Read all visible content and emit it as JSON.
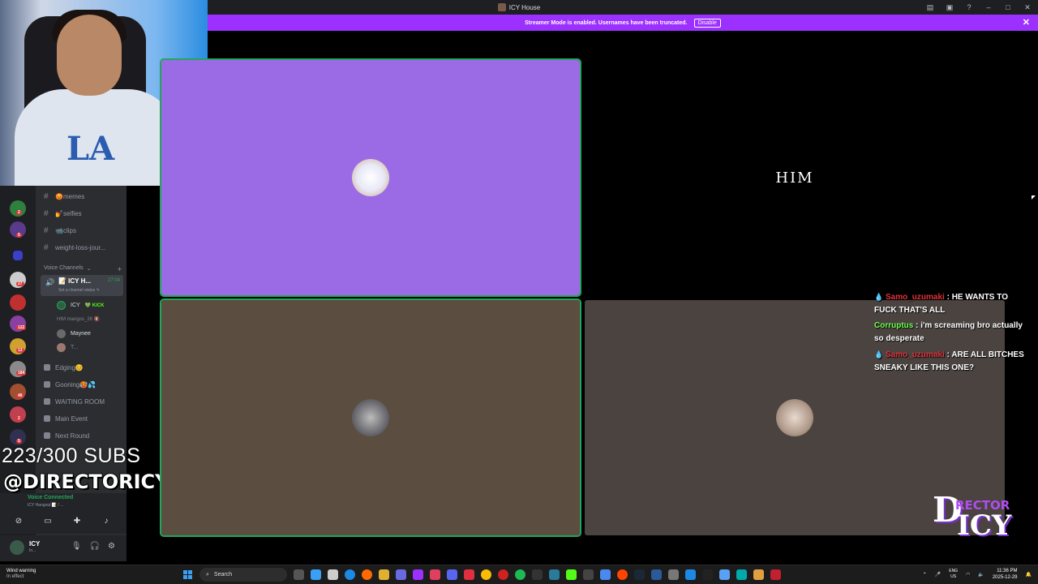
{
  "window": {
    "title": "ICY House"
  },
  "banner": {
    "text": "Streamer Mode is enabled. Usernames have been truncated.",
    "disable_label": "Disable",
    "close": "✕"
  },
  "rail_badges": [
    "2",
    "5",
    "27",
    "122",
    "13",
    "184",
    "46",
    "2",
    "5"
  ],
  "channels": [
    {
      "emoji": "😡",
      "name": "memes"
    },
    {
      "emoji": "💅",
      "name": "selfies"
    },
    {
      "emoji": "📹",
      "name": "clips"
    },
    {
      "emoji": "",
      "name": "weight-loss-jour..."
    }
  ],
  "voice_header": {
    "label": "Voice Channels",
    "plus": "+"
  },
  "active_voice": {
    "name": "📝 ICY H...",
    "time": "27:04",
    "status": "Set a channel status ✎"
  },
  "members": [
    {
      "name": "ICY",
      "tag": "💚 KICK"
    },
    {
      "name": "HIM  mangos_26  🔇"
    },
    {
      "name": "Maynee"
    },
    {
      "name": "T..."
    }
  ],
  "voice_channels": [
    {
      "name": "Edging😊"
    },
    {
      "name": "Gooning🥵💦"
    },
    {
      "name": "WAITING ROOM"
    },
    {
      "name": "Main Event"
    },
    {
      "name": "Next Round"
    }
  ],
  "overlay": {
    "subs": "223/300 SUBS",
    "handle": "@DIRECTORICY"
  },
  "voice_panel": {
    "status": "Voice Connected",
    "channel": "ICY Hangout 📝 / ..."
  },
  "user_panel": {
    "name": "ICY",
    "status": "In..."
  },
  "tiles": {
    "him_label": "HIM"
  },
  "chat": [
    {
      "user": "Samo_uzumaki",
      "color": "red",
      "text": "HE WANTS TO FUCK THAT'S ALL"
    },
    {
      "user": "Corruptus",
      "color": "green",
      "text": "i'm screaming bro actually so desperate"
    },
    {
      "user": "Samo_uzumaki",
      "color": "red",
      "text": "ARE ALL BITCHES SNEAKY LIKE THIS ONE?"
    }
  ],
  "logo": {
    "d": "D",
    "rector": "RECTOR",
    "icy": "ICY"
  },
  "taskbar": {
    "weather_title": "Wind warning",
    "weather_sub": "In effect",
    "search_placeholder": "Search",
    "lang_top": "ENG",
    "lang_bottom": "US",
    "time": "11:36 PM",
    "date": "2025-12-29"
  },
  "colors": {
    "accent": "#9b30ff",
    "speaking": "#23a55a",
    "tile_purple": "#9b6be6",
    "tile_brown": "#5b4d3f"
  }
}
